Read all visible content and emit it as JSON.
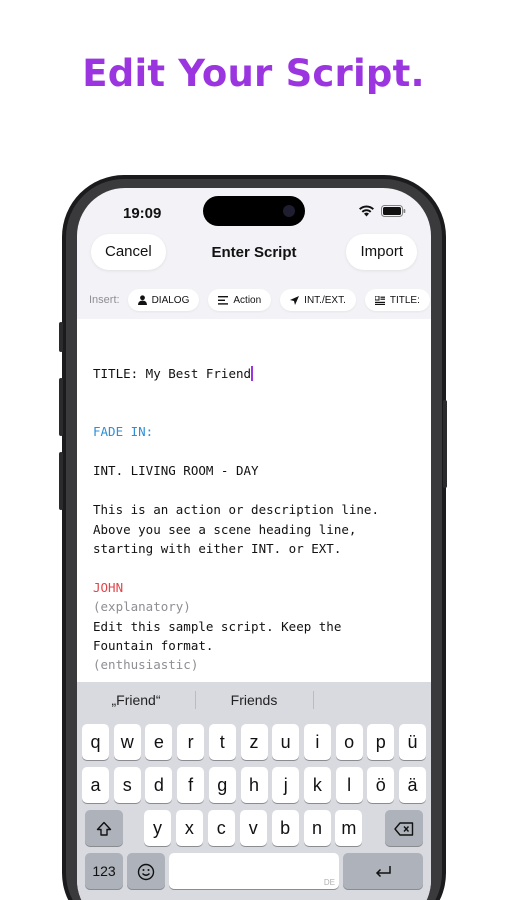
{
  "headline": "Edit Your Script.",
  "status": {
    "time": "19:09"
  },
  "nav": {
    "cancel": "Cancel",
    "title": "Enter Script",
    "import": "Import"
  },
  "insert": {
    "label": "Insert:",
    "chips": [
      {
        "label": "DIALOG",
        "icon": "person-icon"
      },
      {
        "label": "Action",
        "icon": "text-lines-icon"
      },
      {
        "label": "INT./EXT.",
        "icon": "location-arrow-icon"
      },
      {
        "label": "TITLE:",
        "icon": "title-icon"
      }
    ]
  },
  "editor": {
    "lines": [
      "TITLE: My Best Friend",
      "FADE IN:",
      "INT. LIVING ROOM - DAY",
      "This is an action or description line.",
      "Above you see a scene heading line,",
      "starting with either INT. or EXT.",
      "JOHN",
      "(explanatory)",
      "Edit this sample script. Keep the",
      "Fountain format.",
      "(enthusiastic)"
    ],
    "colors": {
      "transition": "#2e8fd6",
      "character": "#e0454a",
      "parenthetical": "#8e8e93",
      "cursor": "#9b35e0"
    }
  },
  "keyboard": {
    "suggestions": [
      "„Friend“",
      "Friends"
    ],
    "row1": [
      "q",
      "w",
      "e",
      "r",
      "t",
      "z",
      "u",
      "i",
      "o",
      "p",
      "ü"
    ],
    "row2": [
      "a",
      "s",
      "d",
      "f",
      "g",
      "h",
      "j",
      "k",
      "l",
      "ö",
      "ä"
    ],
    "row3": [
      "y",
      "x",
      "c",
      "v",
      "b",
      "n",
      "m"
    ],
    "numbers_key": "123",
    "language_badge": "DE"
  },
  "colors": {
    "accent": "#9b35e0"
  }
}
